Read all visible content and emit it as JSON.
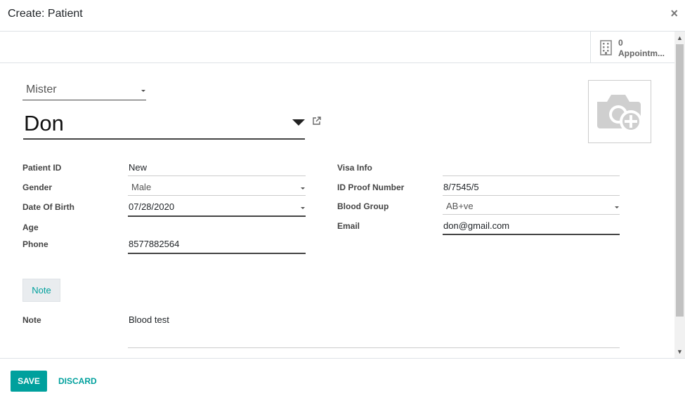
{
  "header": {
    "title": "Create: Patient",
    "close_label": "×"
  },
  "smart_button": {
    "count": "0",
    "label": "Appointm..."
  },
  "colors": {
    "accent": "#00A09D",
    "border": "#dee2e6"
  },
  "form": {
    "title_value": "Mister",
    "name_value": "Don",
    "left_fields": {
      "patient_id": {
        "label": "Patient ID",
        "value": "New"
      },
      "gender": {
        "label": "Gender",
        "value": "Male"
      },
      "date_of_birth": {
        "label": "Date Of Birth",
        "value": "07/28/2020"
      },
      "age": {
        "label": "Age",
        "value": ""
      },
      "phone": {
        "label": "Phone",
        "value": "8577882564"
      }
    },
    "right_fields": {
      "visa_info": {
        "label": "Visa Info",
        "value": ""
      },
      "id_proof_number": {
        "label": "ID Proof Number",
        "value": "8/7545/5"
      },
      "blood_group": {
        "label": "Blood Group",
        "value": "AB+ve"
      },
      "email": {
        "label": "Email",
        "value": "don@gmail.com"
      }
    },
    "notebook": {
      "tab_label": "Note",
      "note_label": "Note",
      "note_value": "Blood test"
    }
  },
  "footer": {
    "save_label": "SAVE",
    "discard_label": "DISCARD"
  },
  "icons": {
    "close": "close-icon",
    "building": "building-icon",
    "camera": "camera-plus-icon",
    "external_link": "external-link-icon",
    "dropdown": "chevron-down-icon"
  }
}
